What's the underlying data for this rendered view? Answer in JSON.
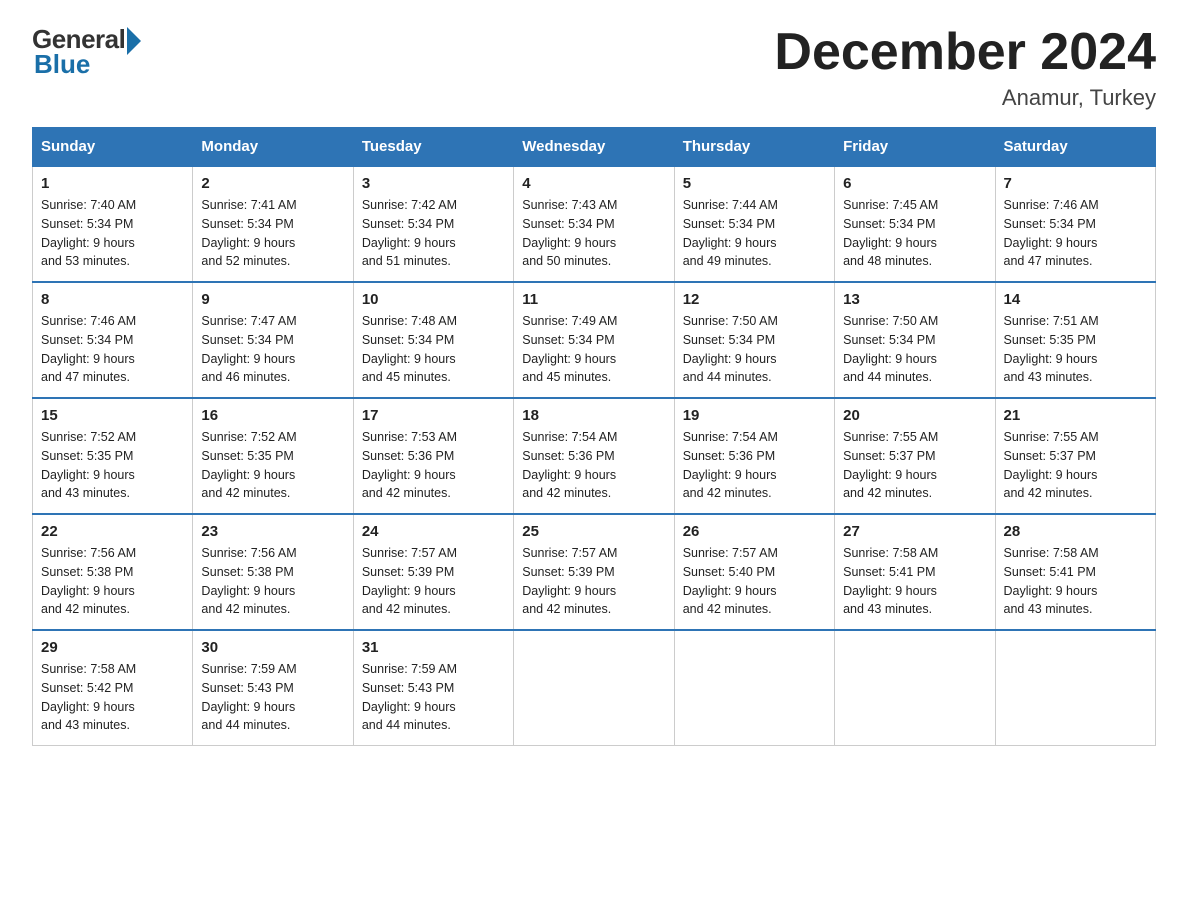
{
  "logo": {
    "general": "General",
    "blue": "Blue"
  },
  "title": "December 2024",
  "location": "Anamur, Turkey",
  "weekdays": [
    "Sunday",
    "Monday",
    "Tuesday",
    "Wednesday",
    "Thursday",
    "Friday",
    "Saturday"
  ],
  "weeks": [
    [
      {
        "day": "1",
        "sunrise": "7:40 AM",
        "sunset": "5:34 PM",
        "daylight": "9 hours and 53 minutes."
      },
      {
        "day": "2",
        "sunrise": "7:41 AM",
        "sunset": "5:34 PM",
        "daylight": "9 hours and 52 minutes."
      },
      {
        "day": "3",
        "sunrise": "7:42 AM",
        "sunset": "5:34 PM",
        "daylight": "9 hours and 51 minutes."
      },
      {
        "day": "4",
        "sunrise": "7:43 AM",
        "sunset": "5:34 PM",
        "daylight": "9 hours and 50 minutes."
      },
      {
        "day": "5",
        "sunrise": "7:44 AM",
        "sunset": "5:34 PM",
        "daylight": "9 hours and 49 minutes."
      },
      {
        "day": "6",
        "sunrise": "7:45 AM",
        "sunset": "5:34 PM",
        "daylight": "9 hours and 48 minutes."
      },
      {
        "day": "7",
        "sunrise": "7:46 AM",
        "sunset": "5:34 PM",
        "daylight": "9 hours and 47 minutes."
      }
    ],
    [
      {
        "day": "8",
        "sunrise": "7:46 AM",
        "sunset": "5:34 PM",
        "daylight": "9 hours and 47 minutes."
      },
      {
        "day": "9",
        "sunrise": "7:47 AM",
        "sunset": "5:34 PM",
        "daylight": "9 hours and 46 minutes."
      },
      {
        "day": "10",
        "sunrise": "7:48 AM",
        "sunset": "5:34 PM",
        "daylight": "9 hours and 45 minutes."
      },
      {
        "day": "11",
        "sunrise": "7:49 AM",
        "sunset": "5:34 PM",
        "daylight": "9 hours and 45 minutes."
      },
      {
        "day": "12",
        "sunrise": "7:50 AM",
        "sunset": "5:34 PM",
        "daylight": "9 hours and 44 minutes."
      },
      {
        "day": "13",
        "sunrise": "7:50 AM",
        "sunset": "5:34 PM",
        "daylight": "9 hours and 44 minutes."
      },
      {
        "day": "14",
        "sunrise": "7:51 AM",
        "sunset": "5:35 PM",
        "daylight": "9 hours and 43 minutes."
      }
    ],
    [
      {
        "day": "15",
        "sunrise": "7:52 AM",
        "sunset": "5:35 PM",
        "daylight": "9 hours and 43 minutes."
      },
      {
        "day": "16",
        "sunrise": "7:52 AM",
        "sunset": "5:35 PM",
        "daylight": "9 hours and 42 minutes."
      },
      {
        "day": "17",
        "sunrise": "7:53 AM",
        "sunset": "5:36 PM",
        "daylight": "9 hours and 42 minutes."
      },
      {
        "day": "18",
        "sunrise": "7:54 AM",
        "sunset": "5:36 PM",
        "daylight": "9 hours and 42 minutes."
      },
      {
        "day": "19",
        "sunrise": "7:54 AM",
        "sunset": "5:36 PM",
        "daylight": "9 hours and 42 minutes."
      },
      {
        "day": "20",
        "sunrise": "7:55 AM",
        "sunset": "5:37 PM",
        "daylight": "9 hours and 42 minutes."
      },
      {
        "day": "21",
        "sunrise": "7:55 AM",
        "sunset": "5:37 PM",
        "daylight": "9 hours and 42 minutes."
      }
    ],
    [
      {
        "day": "22",
        "sunrise": "7:56 AM",
        "sunset": "5:38 PM",
        "daylight": "9 hours and 42 minutes."
      },
      {
        "day": "23",
        "sunrise": "7:56 AM",
        "sunset": "5:38 PM",
        "daylight": "9 hours and 42 minutes."
      },
      {
        "day": "24",
        "sunrise": "7:57 AM",
        "sunset": "5:39 PM",
        "daylight": "9 hours and 42 minutes."
      },
      {
        "day": "25",
        "sunrise": "7:57 AM",
        "sunset": "5:39 PM",
        "daylight": "9 hours and 42 minutes."
      },
      {
        "day": "26",
        "sunrise": "7:57 AM",
        "sunset": "5:40 PM",
        "daylight": "9 hours and 42 minutes."
      },
      {
        "day": "27",
        "sunrise": "7:58 AM",
        "sunset": "5:41 PM",
        "daylight": "9 hours and 43 minutes."
      },
      {
        "day": "28",
        "sunrise": "7:58 AM",
        "sunset": "5:41 PM",
        "daylight": "9 hours and 43 minutes."
      }
    ],
    [
      {
        "day": "29",
        "sunrise": "7:58 AM",
        "sunset": "5:42 PM",
        "daylight": "9 hours and 43 minutes."
      },
      {
        "day": "30",
        "sunrise": "7:59 AM",
        "sunset": "5:43 PM",
        "daylight": "9 hours and 44 minutes."
      },
      {
        "day": "31",
        "sunrise": "7:59 AM",
        "sunset": "5:43 PM",
        "daylight": "9 hours and 44 minutes."
      },
      null,
      null,
      null,
      null
    ]
  ],
  "labels": {
    "sunrise": "Sunrise:",
    "sunset": "Sunset:",
    "daylight": "Daylight:"
  }
}
